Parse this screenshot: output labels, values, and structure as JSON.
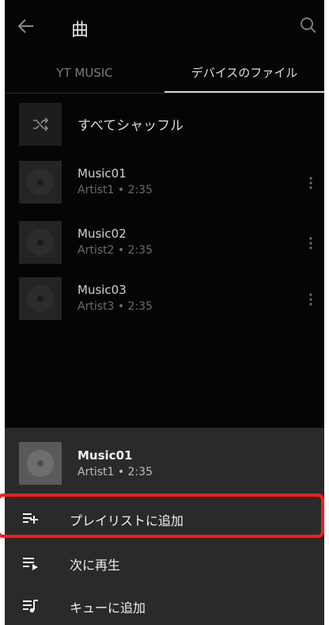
{
  "header": {
    "title": "曲"
  },
  "tabs": [
    {
      "label": "YT MUSIC"
    },
    {
      "label": "デバイスのファイル"
    }
  ],
  "shuffle": {
    "label": "すべてシャッフル"
  },
  "songs": [
    {
      "title": "Music01",
      "subtitle": "Artist1 • 2:35"
    },
    {
      "title": "Music02",
      "subtitle": "Artist2 • 2:35"
    },
    {
      "title": "Music03",
      "subtitle": "Artist3 • 2:35"
    }
  ],
  "sheet": {
    "song": {
      "title": "Music01",
      "subtitle": "Artist1 • 2:35"
    },
    "actions": [
      {
        "label": "プレイリストに追加",
        "icon": "playlist-add-icon"
      },
      {
        "label": "次に再生",
        "icon": "play-next-icon"
      },
      {
        "label": "キューに追加",
        "icon": "add-to-queue-icon"
      }
    ]
  },
  "colors": {
    "highlight": "#ff1a1a"
  }
}
